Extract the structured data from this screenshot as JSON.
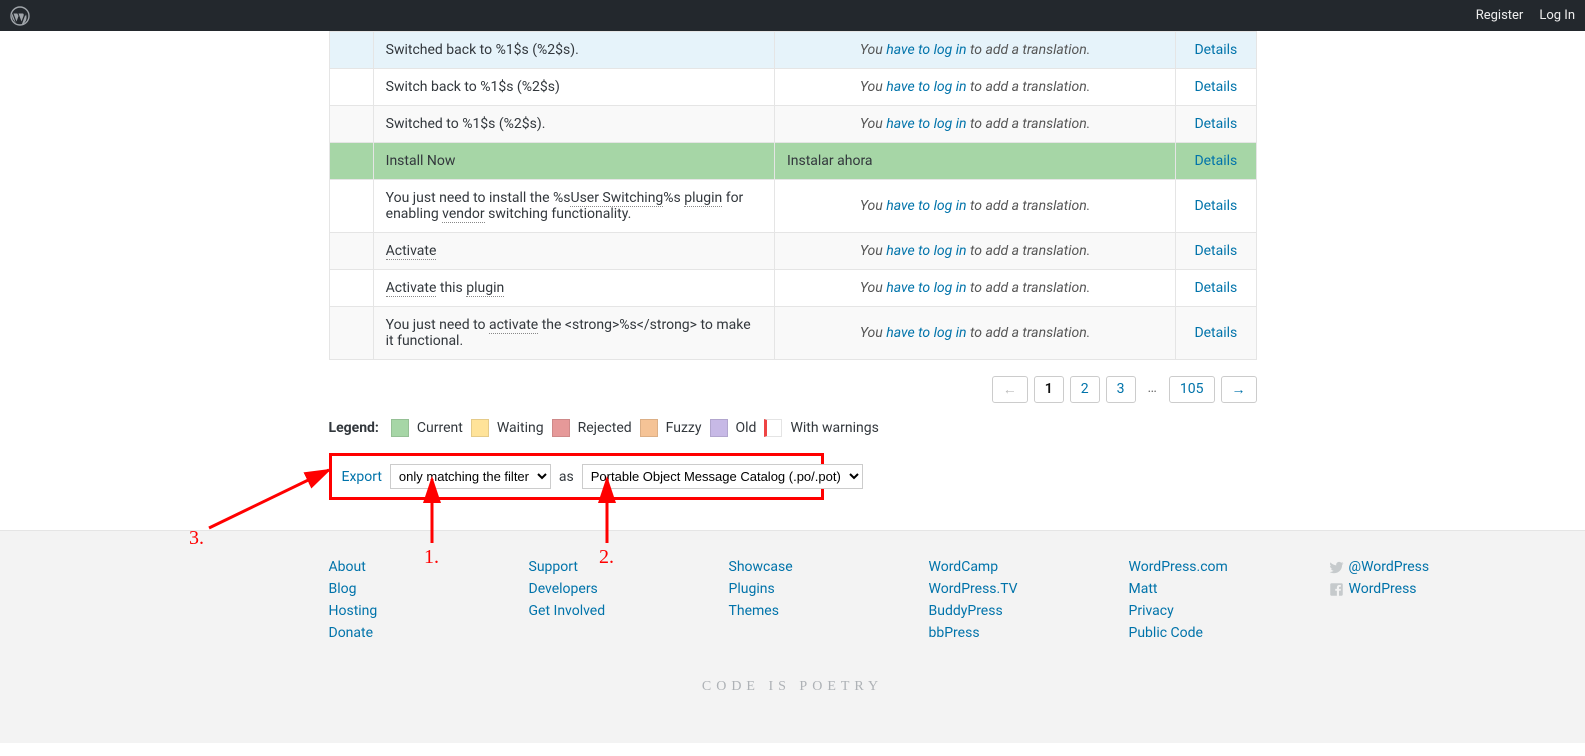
{
  "topbar": {
    "register": "Register",
    "login": "Log In"
  },
  "rows": [
    {
      "cls": "row-fuzzy",
      "source": "Switched back to %1$s (%2$s).",
      "translated": false,
      "details": "Details"
    },
    {
      "cls": "row-even",
      "source": "Switch back to %1$s (%2$s)",
      "translated": false,
      "details": "Details"
    },
    {
      "cls": "row-odd",
      "source": "Switched to %1$s (%2$s).",
      "translated": false,
      "details": "Details"
    },
    {
      "cls": "row-current",
      "source": "Install Now",
      "translated": true,
      "translation": "Instalar ahora",
      "details": "Details"
    },
    {
      "cls": "row-even",
      "rich": true,
      "pre1": "You just need to install the %s",
      "d1": "User Switching",
      "mid1": "%s ",
      "d2": "plugin",
      "post1": " for enabling ",
      "d3": "vendor",
      "post2": " switching functionality.",
      "translated": false,
      "details": "Details"
    },
    {
      "cls": "row-odd",
      "rich": true,
      "d1": "Activate",
      "translated": false,
      "details": "Details"
    },
    {
      "cls": "row-even",
      "rich": true,
      "d1": "Activate",
      "mid1": " this ",
      "d2": "plugin",
      "translated": false,
      "details": "Details"
    },
    {
      "cls": "row-odd",
      "rich": true,
      "pre1": "You just need to ",
      "d1": "activate",
      "mid1": " the <strong>%s</strong> to make it functional.",
      "translated": false,
      "details": "Details"
    }
  ],
  "needLogin": {
    "prefix": "You ",
    "link": "have to log in",
    "suffix": " to add a translation."
  },
  "pagination": {
    "prev": "←",
    "current": "1",
    "p2": "2",
    "p3": "3",
    "dots": "…",
    "p105": "105",
    "next": "→"
  },
  "legend": {
    "label": "Legend:",
    "current": "Current",
    "waiting": "Waiting",
    "rejected": "Rejected",
    "fuzzy": "Fuzzy",
    "old": "Old",
    "warnings": "With warnings"
  },
  "export": {
    "link": "Export",
    "filter_sel": "only matching the filter",
    "as": "as",
    "format_sel": "Portable Object Message Catalog (.po/.pot)"
  },
  "annotations": {
    "n1": "1.",
    "n2": "2.",
    "n3": "3."
  },
  "footer": {
    "col1": [
      "About",
      "Blog",
      "Hosting",
      "Donate"
    ],
    "col2": [
      "Support",
      "Developers",
      "Get Involved"
    ],
    "col3": [
      "Showcase",
      "Plugins",
      "Themes"
    ],
    "col4": [
      "WordCamp",
      "WordPress.TV",
      "BuddyPress",
      "bbPress"
    ],
    "col5": [
      "WordPress.com",
      "Matt",
      "Privacy",
      "Public Code"
    ],
    "twitter": "@WordPress",
    "facebook": "WordPress",
    "tagline": "Code is Poetry"
  }
}
